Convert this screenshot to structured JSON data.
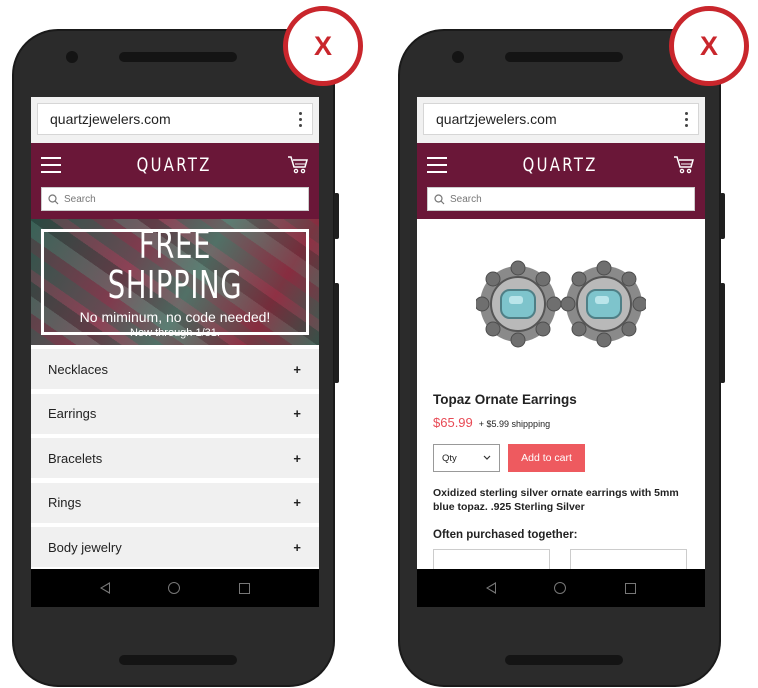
{
  "left_phone": {
    "url": "quartzjewelers.com",
    "brand": "QUARTZ",
    "search_placeholder": "Search",
    "banner": {
      "title": "FREE SHIPPING",
      "subtitle": "No miminum, no code needed!",
      "date": "Now through 1/31."
    },
    "categories": [
      {
        "label": "Necklaces",
        "expand": "+"
      },
      {
        "label": "Earrings",
        "expand": "+"
      },
      {
        "label": "Bracelets",
        "expand": "+"
      },
      {
        "label": "Rings",
        "expand": "+"
      },
      {
        "label": "Body jewelry",
        "expand": "+"
      }
    ]
  },
  "right_phone": {
    "url": "quartzjewelers.com",
    "brand": "QUARTZ",
    "search_placeholder": "Search",
    "product": {
      "name": "Topaz Ornate Earrings",
      "price": "$65.99",
      "shipping": "+ $5.99 shippping",
      "qty_label": "Qty",
      "add_to_cart": "Add to cart",
      "description": "Oxidized sterling silver ornate earrings with 5mm blue topaz. .925 Sterling Silver",
      "often_purchased": "Often purchased together:"
    }
  },
  "overlay": {
    "left_mark": "X",
    "right_mark": "X",
    "mark_color": "#c9262c"
  },
  "colors": {
    "header": "#6a1738",
    "price": "#e84a55",
    "add_button": "#ee5a5f",
    "category_bg": "#f0f0f0"
  }
}
